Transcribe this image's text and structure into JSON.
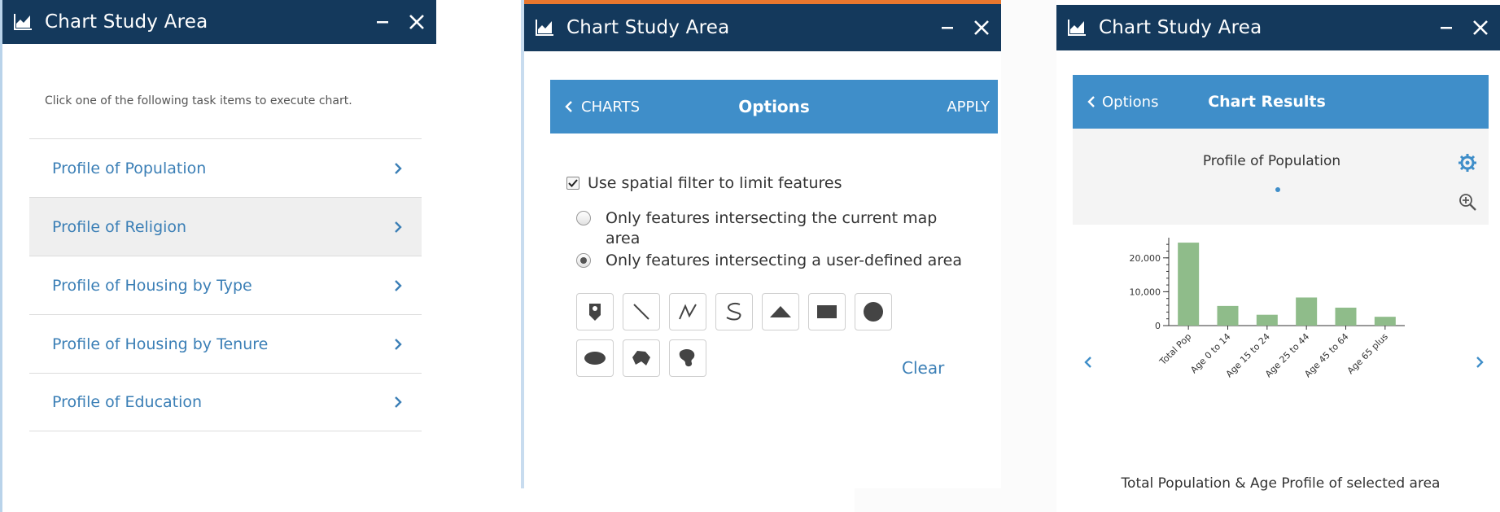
{
  "window_title": "Chart Study Area",
  "colors": {
    "titlebar": "#14395c",
    "accent": "#3f8ec9",
    "link": "#3b7fb6",
    "bar": "#8fbc8a"
  },
  "panel1": {
    "instruction": "Click one of the following task items to execute chart.",
    "tasks": [
      {
        "label": "Profile of Population"
      },
      {
        "label": "Profile of Religion"
      },
      {
        "label": "Profile of Housing by Type"
      },
      {
        "label": "Profile of Housing by Tenure"
      },
      {
        "label": "Profile of Education"
      }
    ]
  },
  "panel2": {
    "back_label": "CHARTS",
    "title": "Options",
    "apply_label": "APPLY",
    "spatial_filter_label": "Use spatial filter to limit features",
    "spatial_filter_checked": true,
    "radio_options": [
      {
        "label": "Only features intersecting the current map area",
        "selected": false
      },
      {
        "label": "Only features intersecting a user-defined area",
        "selected": true
      }
    ],
    "draw_tools": [
      "point-marker-icon",
      "line-icon",
      "polyline-icon",
      "freehand-line-icon",
      "triangle-icon",
      "rectangle-icon",
      "circle-icon",
      "ellipse-icon",
      "polygon-icon",
      "freehand-polygon-icon"
    ],
    "clear_label": "Clear"
  },
  "panel3": {
    "back_label": "Options",
    "title": "Chart Results",
    "chart_title": "Profile of Population",
    "caption": "Total Population & Age Profile of selected area"
  },
  "chart_data": {
    "type": "bar",
    "title": "Profile of Population",
    "categories": [
      "Total Pop",
      "Age 0 to 14",
      "Age 15 to 24",
      "Age 25 to 44",
      "Age 45 to 64",
      "Age 65 plus"
    ],
    "values": [
      24500,
      5800,
      3200,
      8300,
      5300,
      2600
    ],
    "yticks": [
      0,
      10000,
      20000
    ],
    "ytick_labels": [
      "0",
      "10,000",
      "20,000"
    ],
    "ylim": [
      0,
      25000
    ],
    "grid": false,
    "legend": "none"
  }
}
